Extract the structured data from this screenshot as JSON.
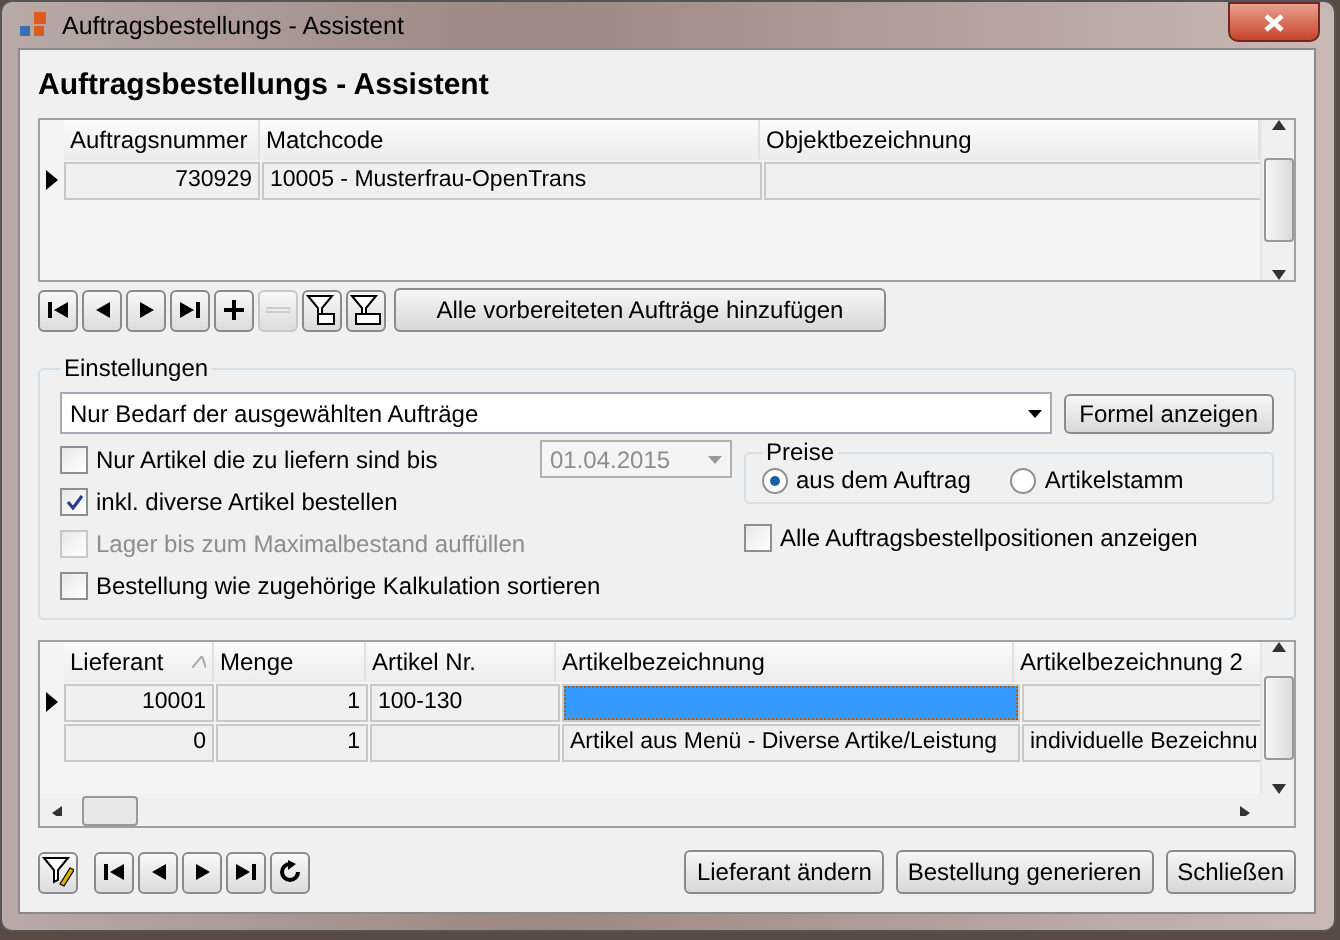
{
  "window": {
    "title": "Auftragsbestellungs - Assistent"
  },
  "heading": "Auftragsbestellungs - Assistent",
  "orders": {
    "columns": [
      "Auftragsnummer",
      "Matchcode",
      "Objektbezeichnung"
    ],
    "rows": [
      {
        "current": true,
        "cells": [
          "730929",
          "10005 - Musterfrau-OpenTrans",
          ""
        ]
      }
    ]
  },
  "order_toolbar": [
    {
      "kind": "first",
      "disabled": false
    },
    {
      "kind": "prev",
      "disabled": false
    },
    {
      "kind": "next",
      "disabled": false
    },
    {
      "kind": "last",
      "disabled": false
    },
    {
      "kind": "add",
      "disabled": false
    },
    {
      "kind": "remove",
      "disabled": true
    },
    {
      "kind": "filter-a",
      "disabled": false
    },
    {
      "kind": "filter-b",
      "disabled": false
    },
    {
      "kind": "text",
      "label": "Alle vorbereiteten Aufträge hinzufügen",
      "disabled": false
    }
  ],
  "settings": {
    "title": "Einstellungen",
    "mode": "Nur Bedarf der ausgewählten Aufträge",
    "formula_button": "Formel anzeigen",
    "options": [
      {
        "label": "Nur Artikel die zu liefern sind bis",
        "checked": false,
        "disabled": false
      },
      {
        "label": "inkl. diverse Artikel bestellen",
        "checked": true,
        "disabled": false
      },
      {
        "label": "Lager bis zum Maximalbestand auffüllen",
        "checked": false,
        "disabled": true
      },
      {
        "label": "Bestellung wie zugehörige Kalkulation sortieren",
        "checked": false,
        "disabled": false
      }
    ],
    "date": {
      "value": "01.04.2015",
      "disabled": true
    },
    "prices": {
      "title": "Preise",
      "options": [
        {
          "label": "aus dem Auftrag",
          "selected": true
        },
        {
          "label": "Artikelstamm",
          "selected": false
        }
      ]
    },
    "show_all": {
      "label": "Alle Auftragsbestellpositionen anzeigen",
      "checked": false
    }
  },
  "positions": {
    "columns": [
      {
        "label": "Lieferant",
        "sorted": true
      },
      {
        "label": "Menge",
        "sorted": false
      },
      {
        "label": "Artikel Nr.",
        "sorted": false
      },
      {
        "label": "Artikelbezeichnung",
        "sorted": false
      },
      {
        "label": "Artikelbezeichnung 2",
        "sorted": false
      }
    ],
    "rows": [
      {
        "current": true,
        "cells": [
          {
            "text": "10001",
            "selected": false
          },
          {
            "text": "1",
            "selected": false
          },
          {
            "text": "100-130",
            "selected": false
          },
          {
            "text": "",
            "selected": true
          },
          {
            "text": "",
            "selected": false
          }
        ]
      },
      {
        "current": false,
        "cells": [
          {
            "text": "0",
            "selected": false
          },
          {
            "text": "1",
            "selected": false
          },
          {
            "text": "",
            "selected": false
          },
          {
            "text": "Artikel aus Menü - Diverse Artike/Leistung",
            "selected": false
          },
          {
            "text": "individuelle Bezeichnu",
            "selected": false
          }
        ]
      }
    ]
  },
  "footer_toolbar": [
    {
      "kind": "filter-edit"
    },
    {
      "kind": "first"
    },
    {
      "kind": "prev"
    },
    {
      "kind": "next"
    },
    {
      "kind": "last"
    },
    {
      "kind": "refresh"
    }
  ],
  "footer_buttons": [
    "Lieferant ändern",
    "Bestellung generieren",
    "Schließen"
  ]
}
